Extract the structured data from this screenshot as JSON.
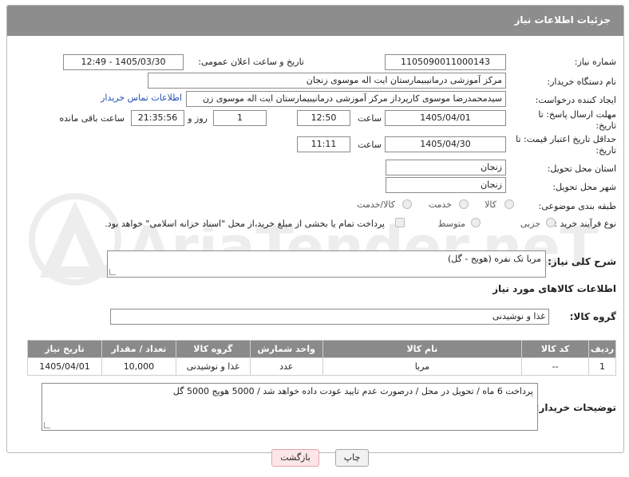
{
  "header": {
    "title": "جزئیات اطلاعات نیاز"
  },
  "fields": {
    "need_number_label": "شماره نیاز:",
    "need_number": "1105090011000143",
    "announce_label": "تاریخ و ساعت اعلان عمومی:",
    "announce_value": "1405/03/30 - 12:49",
    "buyer_org_label": "نام دستگاه خریدار:",
    "buyer_org": "مرکز آموزشی درمانیبیمارستان ایت اله موسوی زنجان",
    "creator_label": "ایجاد کننده درخواست:",
    "creator": "سیدمحمدرضا موسوی کارپرداز مرکز آموزشی درمانیبیمارستان ایت اله موسوی زن",
    "contact_link": "اطلاعات تماس خریدار",
    "reply_deadline_label": "مهلت ارسال پاسخ: تا تاریخ:",
    "reply_date": "1405/04/01",
    "time_label": "ساعت",
    "reply_time": "12:50",
    "days_value": "1",
    "days_label": "روز و",
    "remaining_value": "21:35:56",
    "remaining_label": "ساعت باقی مانده",
    "price_validity_label": "حداقل تاریخ اعتبار قیمت: تا تاریخ:",
    "price_date": "1405/04/30",
    "price_time": "11:11",
    "province_label": "استان محل تحویل:",
    "province": "زنجان",
    "city_label": "شهر محل تحویل:",
    "city": "زنجان",
    "category_label": "طبقه بندی موضوعی:",
    "category_options": [
      "کالا",
      "خدمت",
      "کالا/خدمت"
    ],
    "process_label": "نوع فرآیند خرید :",
    "process_options": [
      "جزیی",
      "متوسط"
    ],
    "payment_note": "پرداخت تمام یا بخشی از مبلغ خرید،از محل \"اسناد خزانه اسلامی\" خواهد بود."
  },
  "description": {
    "label": "شرح کلی نیاز:",
    "value": "مربا تک نفره (هویج - گل)"
  },
  "goods_info_title": "اطلاعات کالاهای مورد نیاز",
  "goods_group": {
    "label": "گروه کالا:",
    "value": "غذا و نوشیدنی"
  },
  "table": {
    "headers": [
      "ردیف",
      "کد کالا",
      "نام کالا",
      "واحد شمارش",
      "گروه کالا",
      "تعداد / مقدار",
      "تاریخ نیاز"
    ],
    "rows": [
      [
        "1",
        "--",
        "مربا",
        "عدد",
        "غذا و نوشیدنی",
        "10,000",
        "1405/04/01"
      ]
    ]
  },
  "buyer_notes": {
    "label": "توضیحات خریدار:",
    "value": "پرداخت 6 ماه / تحویل در محل / درصورت عدم تایید عودت داده خواهد شد / 5000 هویج 5000 گل"
  },
  "buttons": {
    "print": "چاپ",
    "back": "بازگشت"
  },
  "watermark": {
    "text": "AriaTender.neT"
  },
  "colors": {
    "header_bg": "#8d8d8d",
    "link": "#1f4fb0",
    "back_button_bg": "#fde6e8"
  }
}
